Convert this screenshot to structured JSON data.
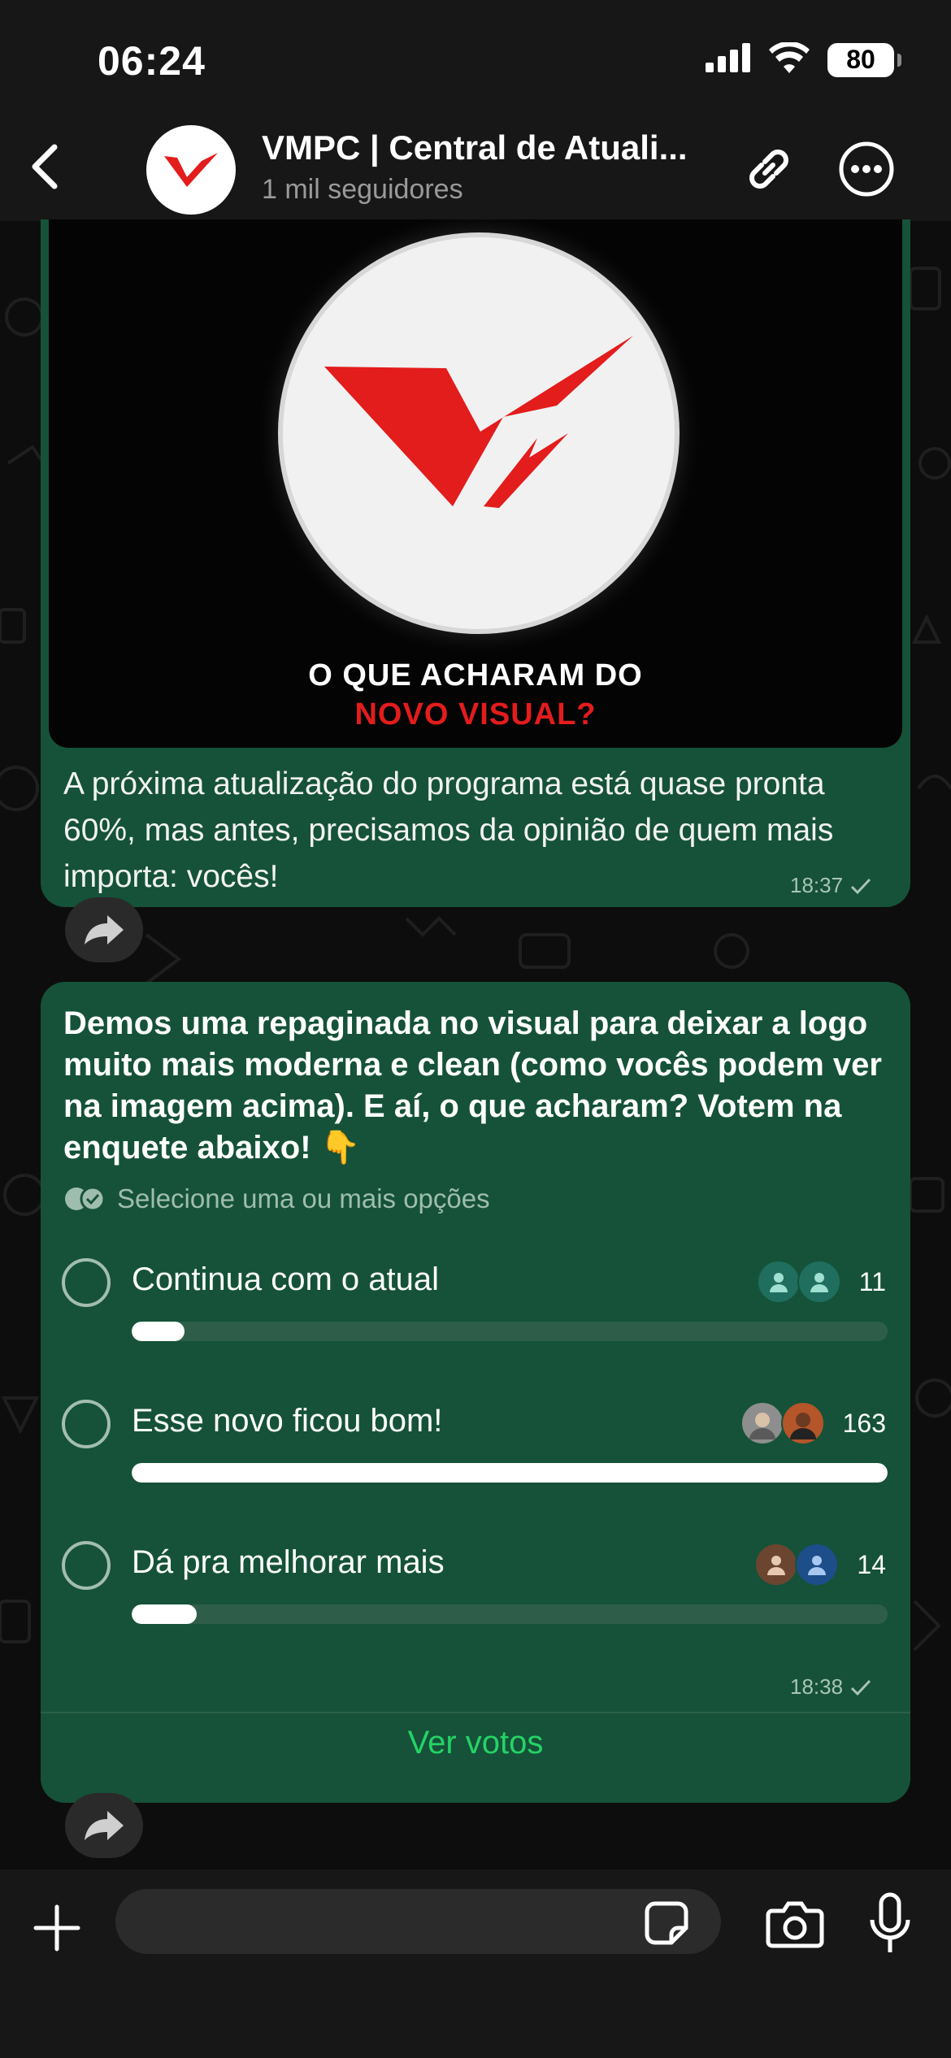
{
  "status_bar": {
    "time": "06:24",
    "battery": "80"
  },
  "header": {
    "channel_name": "VMPC | Central de Atuali...",
    "subtitle": "1 mil seguidores"
  },
  "message1": {
    "image_text_line1": "O QUE ACHARAM DO",
    "image_text_line2": "NOVO VISUAL?",
    "text": "A próxima atualização do programa está quase pronta 60%, mas antes, precisamos da opinião de quem mais importa: vocês!",
    "time": "18:37"
  },
  "poll": {
    "question": "Demos uma repaginada no visual para deixar a logo muito mais moderna e clean (como vocês podem ver na imagem acima). E aí, o que acharam? Votem na enquete abaixo! 👇",
    "hint": "Selecione uma ou mais opções",
    "options": [
      {
        "label": "Continua com o atual",
        "count": "11",
        "fraction": 0.07
      },
      {
        "label": "Esse novo ficou bom!",
        "count": "163",
        "fraction": 1.0
      },
      {
        "label": "Dá pra melhorar mais",
        "count": "14",
        "fraction": 0.086
      }
    ],
    "time": "18:38",
    "view_votes": "Ver votos"
  },
  "input": {
    "placeholder": ""
  },
  "colors": {
    "bubble": "#155239",
    "accent_green": "#25d366",
    "brand_red": "#e31c1c"
  },
  "icons": [
    "back-icon",
    "link-icon",
    "more-icon",
    "forward-icon",
    "plus-icon",
    "sticker-icon",
    "camera-icon",
    "mic-icon",
    "double-check-icon",
    "check-icon"
  ]
}
